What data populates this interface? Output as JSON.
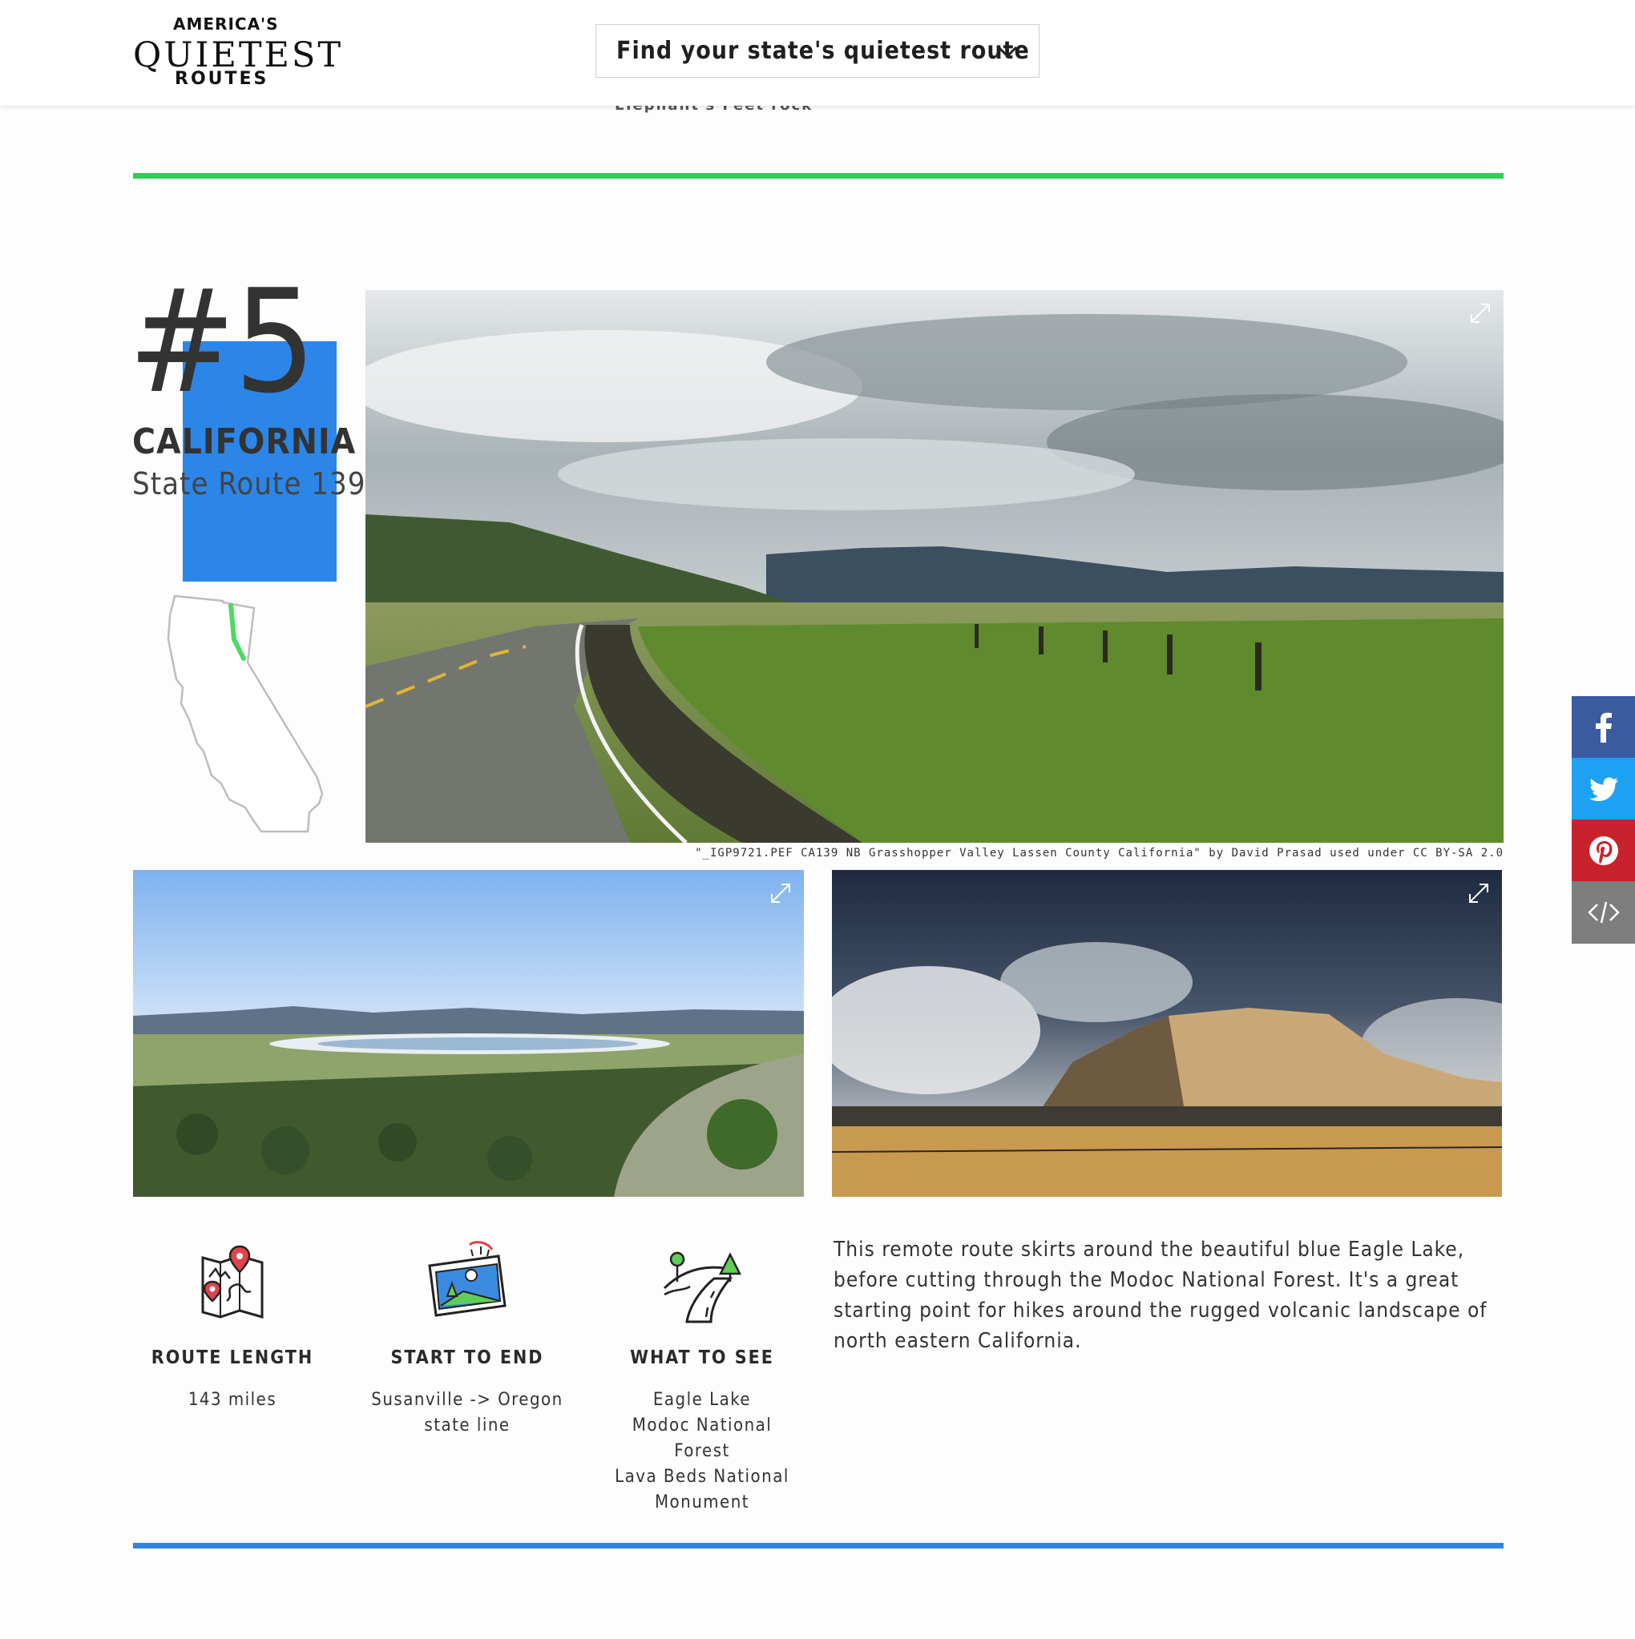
{
  "header": {
    "logo": {
      "line1": "AMERICA'S",
      "line2": "QUIETEST",
      "line3": "ROUTES"
    },
    "dropdown_label": "Find your state's quietest route",
    "previous_entry_fragment": "Elephant's Feet rock"
  },
  "entry": {
    "rank": "#5",
    "state": "CALIFORNIA",
    "route": "State Route 139",
    "main_photo_credit": "\"_IGP9721.PEF CA139 NB Grasshopper Valley Lassen County California\" by David Prasad used under CC BY-SA 2.0",
    "stats": [
      {
        "icon": "map-pins-icon",
        "heading": "ROUTE LENGTH",
        "value": "143 miles"
      },
      {
        "icon": "landscape-postcard-icon",
        "heading": "START TO END",
        "value": "Susanville -> Oregon state line"
      },
      {
        "icon": "winding-road-icon",
        "heading": "WHAT TO SEE",
        "value": "Eagle Lake\nModoc National Forest\nLava Beds National Monument"
      }
    ],
    "description": "This remote route skirts around the beautiful blue Eagle Lake, before cutting through the Modoc National Forest. It's a great starting point for hikes around the rugged volcanic landscape of north eastern California."
  },
  "share": {
    "buttons": [
      "facebook-icon",
      "twitter-icon",
      "pinterest-icon",
      "embed-code-icon"
    ]
  },
  "colors": {
    "accent_blue": "#2b86e8",
    "accent_green": "#2fcf55",
    "facebook": "#3a5ba0",
    "twitter": "#1da1f2",
    "pinterest": "#c8232c",
    "embed": "#7e7e7e"
  }
}
